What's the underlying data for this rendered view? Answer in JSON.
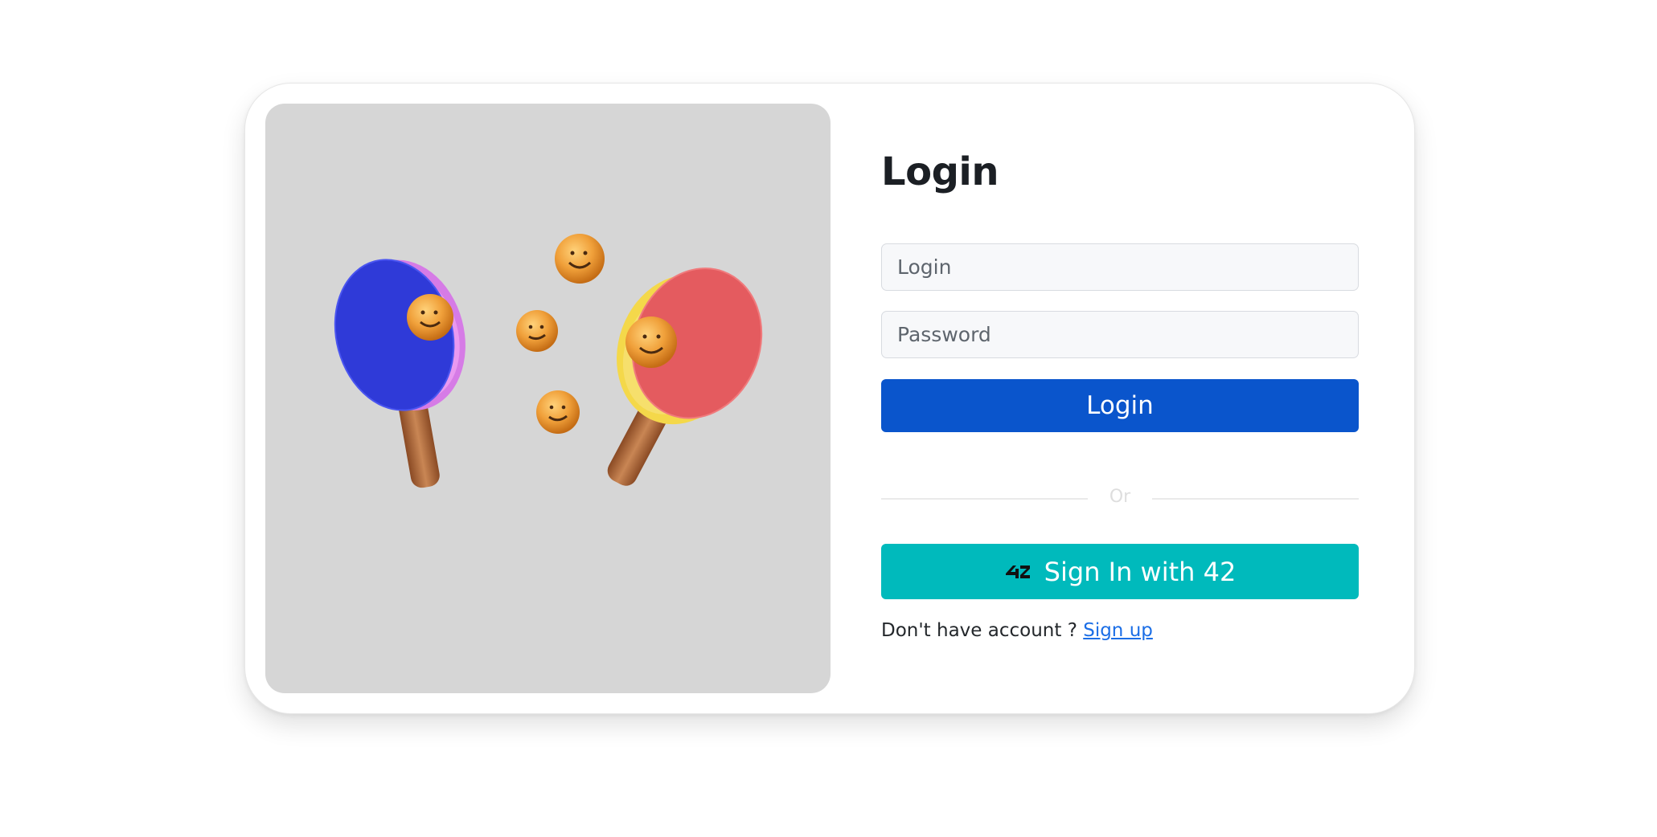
{
  "illustration": {
    "icon": "ping-pong-paddles-illustration",
    "colors": {
      "background": "#d6d6d6",
      "left_paddle": "#2f3ad8",
      "right_paddle": "#e45b5f",
      "balls": "#eb9b2b",
      "handle": "#b36b3a"
    }
  },
  "form": {
    "title": "Login",
    "login_placeholder": "Login",
    "password_placeholder": "Password",
    "login_button": "Login",
    "divider_text": "Or",
    "sign_in_42_label": "Sign In with 42",
    "sign_in_42_icon": "logo-42-icon",
    "no_account_text": "Don't have account ?",
    "signup_link": "Sign up"
  },
  "colors": {
    "primary": "#0a55cc",
    "oauth42": "#00babc",
    "link": "#1b6ee6"
  }
}
